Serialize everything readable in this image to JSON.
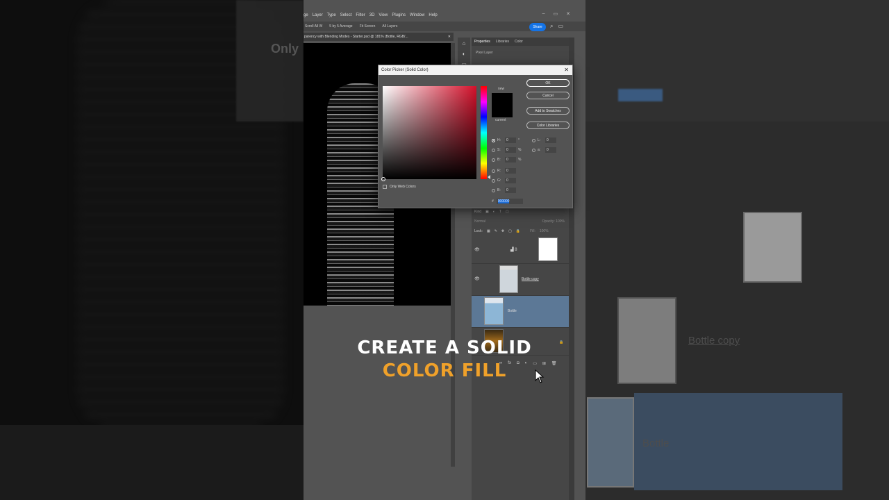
{
  "menu": {
    "items": [
      "ge",
      "Layer",
      "Type",
      "Select",
      "Filter",
      "3D",
      "View",
      "Plugins",
      "Window",
      "Help"
    ]
  },
  "window_controls": [
    "–",
    "▭",
    "✕"
  ],
  "options_bar": {
    "scroll_all": "Scroll All W",
    "sample": "5 by 5 Average",
    "fit_screen": "Fit Screen",
    "all_layers": "All Layers",
    "share_label": "Share"
  },
  "document_tab": {
    "title": "parency with Blending Modes - Starter.psd @ 181% (Bottle, RGB/..."
  },
  "properties_panel": {
    "tabs": [
      "Properties",
      "Libraries",
      "Color"
    ],
    "pixel_layer": "Pixel Layer"
  },
  "layers_panel": {
    "kind_label": "Kind",
    "blend_mode": "Normal",
    "opacity_label": "Opacity:",
    "opacity_value": "100%",
    "lock_label": "Lock:",
    "fill_label": "Fill:",
    "fill_value": "100%",
    "layers": [
      {
        "name": "",
        "visible": true,
        "type": "adjustment"
      },
      {
        "name": "Bottle copy",
        "visible": true,
        "type": "image"
      },
      {
        "name": "Bottle",
        "visible": false,
        "type": "image",
        "selected": true
      },
      {
        "name": "Background",
        "visible": false,
        "type": "background",
        "partial_label": "nd"
      }
    ]
  },
  "color_picker": {
    "title": "Color Picker (Solid Color)",
    "close": "✕",
    "new_label": "new",
    "current_label": "current",
    "buttons": {
      "ok": "OK",
      "cancel": "Cancel",
      "add_to_swatches": "Add to Swatches",
      "color_libraries": "Color Libraries"
    },
    "only_web_colors": "Only Web Colors",
    "fields": {
      "H": {
        "value": "0",
        "unit": "°"
      },
      "S": {
        "value": "0",
        "unit": "%"
      },
      "B": {
        "value": "0",
        "unit": "%"
      },
      "R": {
        "value": "0"
      },
      "G": {
        "value": "0"
      },
      "Bb": {
        "value": "0"
      },
      "L": {
        "value": "0"
      },
      "a": {
        "value": "0"
      }
    },
    "field_labels": {
      "H": "H:",
      "S": "S:",
      "B": "B:",
      "R": "R:",
      "G": "G:",
      "Bb": "B:",
      "L": "L:",
      "a": "a:"
    },
    "hex_label": "#",
    "hex_value": "000000",
    "hue_color": "#d3102a",
    "selected_color": "#000000"
  },
  "caption": {
    "line1": "CREATE A SOLID",
    "line2": "COLOR FILL",
    "line2_color": "#f0a12a"
  },
  "ghost": {
    "left_text": "Only",
    "right_layer_name_1": "Bottle copy",
    "right_layer_name_2": "Bottle"
  }
}
